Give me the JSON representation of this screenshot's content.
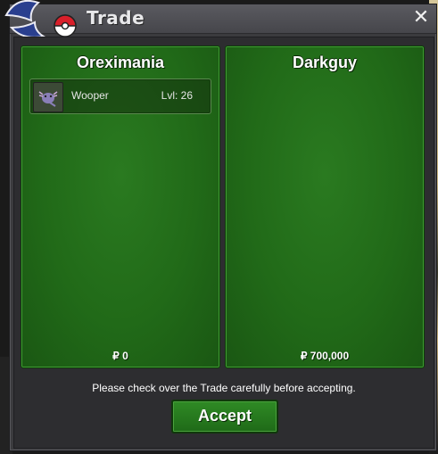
{
  "window": {
    "title": "Trade",
    "close_glyph": "✕",
    "logo_icon": "pokeball-logo-icon"
  },
  "left_panel": {
    "player_name": "Oreximania",
    "items": [
      {
        "name": "Wooper",
        "level": "Lvl: 26",
        "icon": "wooper-icon"
      }
    ],
    "money": "₽ 0"
  },
  "right_panel": {
    "player_name": "Darkguy",
    "items": [],
    "money": "₽ 700,000"
  },
  "footer": {
    "notice": "Please check over the Trade carefully before accepting.",
    "accept_label": "Accept"
  },
  "colors": {
    "panel_green": "#216a18",
    "window_gray": "#3b3b3e",
    "accent_red": "#d91f2a",
    "logo_blue": "#2a3f8f"
  }
}
